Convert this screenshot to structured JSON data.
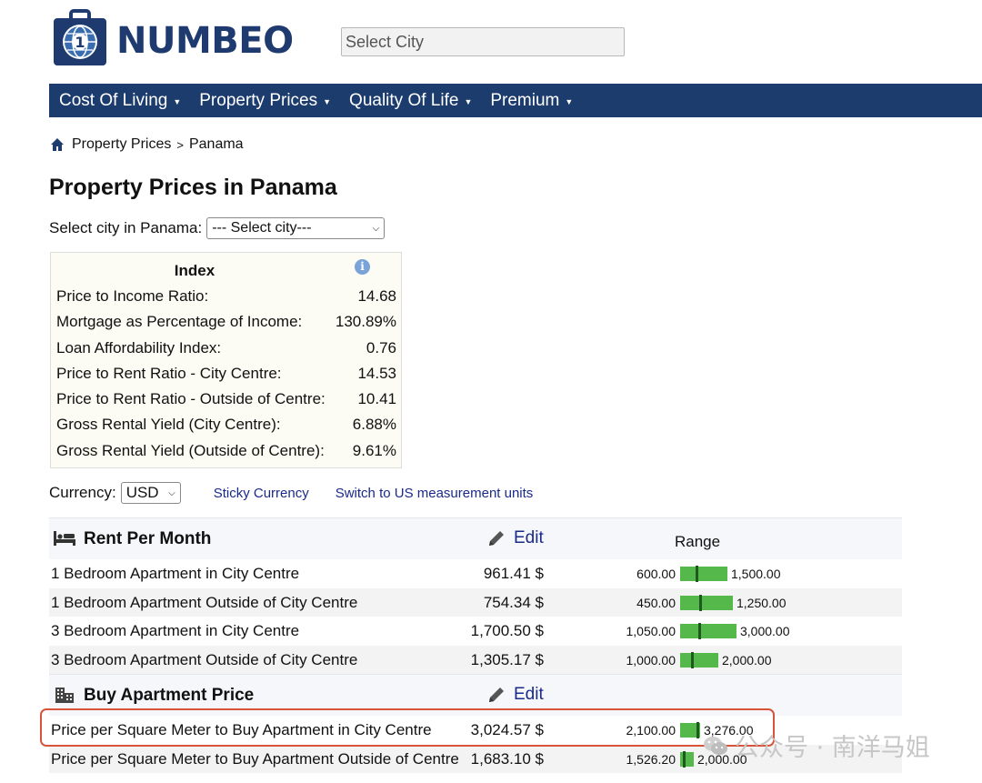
{
  "brand": {
    "name": "NUMBEO"
  },
  "search": {
    "placeholder": "Select City"
  },
  "nav": [
    {
      "label": "Cost Of Living"
    },
    {
      "label": "Property Prices"
    },
    {
      "label": "Quality Of Life"
    },
    {
      "label": "Premium"
    }
  ],
  "breadcrumb": {
    "item1": "Property Prices",
    "sep": ">",
    "item2": "Panama"
  },
  "page": {
    "title": "Property Prices in Panama"
  },
  "city_select": {
    "label": "Select city in Panama:",
    "value": "--- Select city---"
  },
  "index": {
    "title": "Index",
    "rows": [
      {
        "label": "Price to Income Ratio:",
        "value": "14.68"
      },
      {
        "label": "Mortgage as Percentage of Income:",
        "value": "130.89%"
      },
      {
        "label": "Loan Affordability Index:",
        "value": "0.76"
      },
      {
        "label": "Price to Rent Ratio - City Centre:",
        "value": "14.53"
      },
      {
        "label": "Price to Rent Ratio - Outside of Centre:",
        "value": "10.41"
      },
      {
        "label": "Gross Rental Yield (City Centre):",
        "value": "6.88%"
      },
      {
        "label": "Gross Rental Yield (Outside of Centre):",
        "value": "9.61%"
      }
    ]
  },
  "currency": {
    "label": "Currency:",
    "value": "USD",
    "sticky_link": "Sticky Currency",
    "units_link": "Switch to US measurement units"
  },
  "rent": {
    "title": "Rent Per Month",
    "edit": "Edit",
    "range_label": "Range",
    "rows": [
      {
        "label": "1 Bedroom Apartment in City Centre",
        "value": "961.41 $",
        "min": "600.00",
        "max": "1,500.00"
      },
      {
        "label": "1 Bedroom Apartment Outside of City Centre",
        "value": "754.34 $",
        "min": "450.00",
        "max": "1,250.00"
      },
      {
        "label": "3 Bedroom Apartment in City Centre",
        "value": "1,700.50 $",
        "min": "1,050.00",
        "max": "3,000.00"
      },
      {
        "label": "3 Bedroom Apartment Outside of City Centre",
        "value": "1,305.17 $",
        "min": "1,000.00",
        "max": "2,000.00"
      }
    ]
  },
  "buy": {
    "title": "Buy Apartment Price",
    "edit": "Edit",
    "rows": [
      {
        "label": "Price per Square Meter to Buy Apartment in City Centre",
        "value": "3,024.57 $",
        "min": "2,100.00",
        "max": "3,276.00"
      },
      {
        "label": "Price per Square Meter to Buy Apartment Outside of Centre",
        "value": "1,683.10 $",
        "min": "1,526.20",
        "max": "2,000.00"
      }
    ]
  },
  "watermark": {
    "text": "公众号 · 南洋马姐"
  },
  "colors": {
    "nav_bg": "#1d3c6e",
    "bar_green": "#55b84a",
    "highlight": "#d9533b",
    "link": "#1a2a8a"
  }
}
